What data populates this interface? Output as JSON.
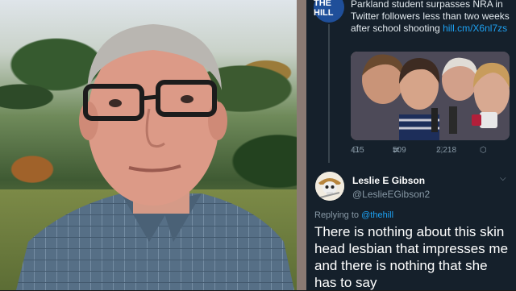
{
  "tweet_quoted": {
    "source_logo": "THE HILL",
    "headline": "Parkland student surpasses NRA in Twitter followers less than two weeks after school shooting",
    "link": "hill.cm/X6nl7zs",
    "replies": "415",
    "retweets": "509",
    "likes": "2,218"
  },
  "reply_tweet": {
    "author_name": "Leslie E Gibson",
    "author_handle": "@LeslieEGibson2",
    "replying_to_prefix": "Replying to",
    "replying_to_handle": "@thehill",
    "text": "There is nothing about this skin head lesbian that impresses me and there is nothing that she has to say"
  },
  "icons": [
    "reply-icon",
    "retweet-icon",
    "like-icon",
    "share-icon",
    "chevron-down-icon"
  ],
  "colors": {
    "tweet_bg": "#15202b",
    "link": "#1da1f2",
    "muted": "#8899a6",
    "text": "#ffffff"
  }
}
